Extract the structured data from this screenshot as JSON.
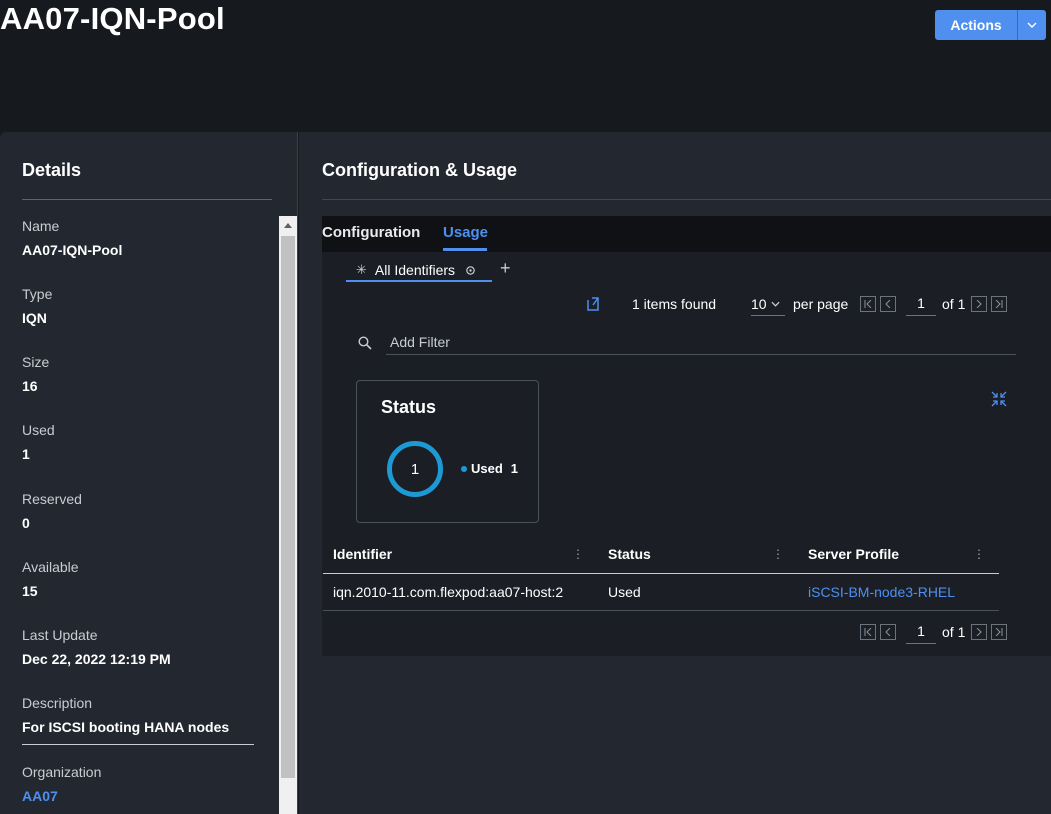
{
  "header": {
    "title": "AA07-IQN-Pool",
    "actions_label": "Actions"
  },
  "details": {
    "title": "Details",
    "fields": [
      {
        "label": "Name",
        "value": "AA07-IQN-Pool"
      },
      {
        "label": "Type",
        "value": "IQN"
      },
      {
        "label": "Size",
        "value": "16"
      },
      {
        "label": "Used",
        "value": "1"
      },
      {
        "label": "Reserved",
        "value": "0"
      },
      {
        "label": "Available",
        "value": "15"
      },
      {
        "label": "Last Update",
        "value": "Dec 22, 2022 12:19 PM"
      },
      {
        "label": "Description",
        "value": "For ISCSI booting HANA nodes"
      },
      {
        "label": "Organization",
        "value": "AA07"
      }
    ]
  },
  "config": {
    "title": "Configuration & Usage",
    "tabs": [
      {
        "label": "Configuration",
        "active": false
      },
      {
        "label": "Usage",
        "active": true
      }
    ],
    "subtab": {
      "label": "All Identifiers"
    },
    "pager": {
      "items_found": "1 items found",
      "per_page_value": "10",
      "per_page_label": "per page",
      "page": "1",
      "of_pages": "of 1"
    },
    "filter": {
      "placeholder": "Add Filter"
    },
    "status_card": {
      "title": "Status",
      "total": "1",
      "legend_label": "Used",
      "legend_value": "1"
    },
    "table": {
      "columns": [
        "Identifier",
        "Status",
        "Server Profile"
      ],
      "rows": [
        {
          "identifier": "iqn.2010-11.com.flexpod:aa07-host:2",
          "status": "Used",
          "server_profile": "iSCSI-BM-node3-RHEL"
        }
      ]
    },
    "bottom_pager": {
      "page": "1",
      "of_pages": "of 1"
    }
  },
  "colors": {
    "accent": "#4e8ff0",
    "donut": "#1d9ad6",
    "background": "#16191e",
    "panel": "#232830"
  }
}
